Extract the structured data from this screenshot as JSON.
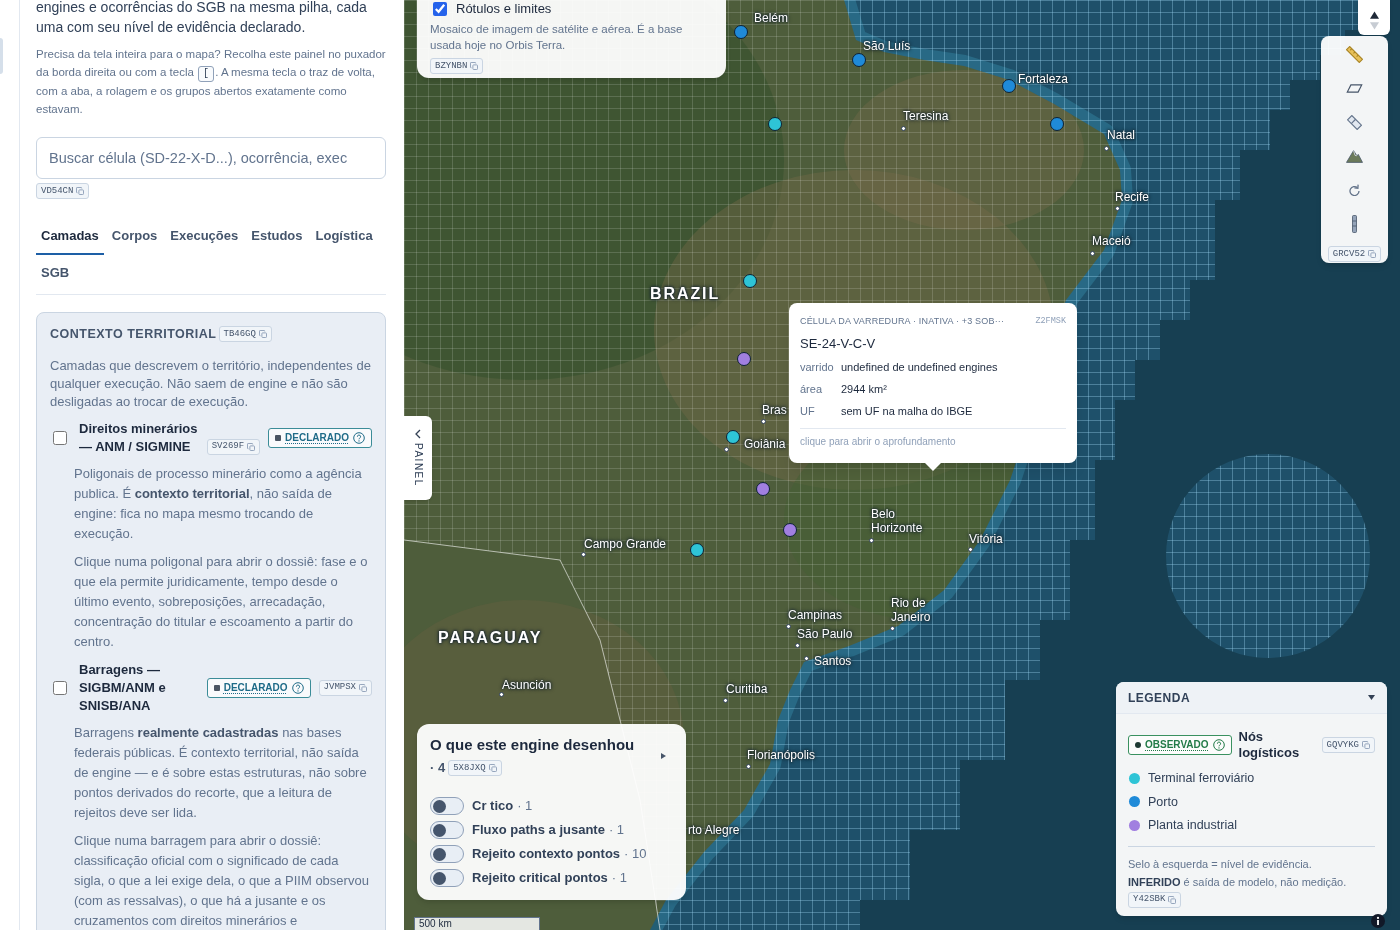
{
  "sidebar": {
    "intro": "engines e ocorrências do SGB na mesma pilha, cada uma com seu nível de evidência declarado.",
    "hint": {
      "before": "Precisa da tela inteira para o mapa? Recolha este painel no puxador da borda direita ou com a tecla ",
      "key": "[",
      "after": ". A mesma tecla o traz de volta, com a aba, a rolagem e os grupos abertos exatamente como estavam."
    },
    "search": {
      "placeholder": "Buscar célula (SD-22-X-D...), ocorrência, exec",
      "tag": "VD54CN"
    },
    "tabs": [
      {
        "label": "Camadas",
        "selected": true
      },
      {
        "label": "Corpos",
        "selected": false
      },
      {
        "label": "Execuções",
        "selected": false
      },
      {
        "label": "Estudos",
        "selected": false
      },
      {
        "label": "Logística",
        "selected": false
      },
      {
        "label": "SGB",
        "selected": false
      }
    ],
    "group": {
      "title": "CONTEXTO TERRITORIAL",
      "tag": "TB46GQ",
      "description": "Camadas que descrevem o território, independentes de qualquer execução. Não saem de engine e não são desligadas ao trocar de execução.",
      "layers": [
        {
          "title": "Direitos minerários — ANM / SIGMINE",
          "title_tag": "SV269F",
          "checked": false,
          "badge": {
            "label": "DECLARADO",
            "kind": "declarado"
          },
          "paragraphs": [
            "Poligonais de processo minerário como a agência publica. É **contexto territorial**, não saída de engine: fica no mapa mesmo trocando de execução.",
            "Clique numa poligonal para abrir o dossiê: fase e o que ela permite juridicamente, tempo desde o último evento, sobreposições, arrecadação, concentração do titular e escoamento a partir do centro."
          ]
        },
        {
          "title": "Barragens — SIGBM/ANM e SNISB/ANA",
          "tag": "JVMPSX",
          "checked": false,
          "badge": {
            "label": "DECLARADO",
            "kind": "declarado"
          },
          "paragraphs": [
            "Barragens **realmente cadastradas** nas bases federais públicas. É contexto territorial, não saída de engine — e é sobre estas estruturas, não sobre pontos derivados do recorte, que a leitura de rejeitos deve ser lida.",
            "Clique numa barragem para abrir o dossiê: classificação oficial com o significado de cada sigla, o que a lei exige dela, o que a PIIM observou (com as ressalvas), o que há a jusante e os cruzamentos com direitos minerários e"
          ]
        }
      ]
    }
  },
  "map": {
    "base_layer": {
      "label": "Rótulos e limites",
      "checked": true,
      "description": "Mosaico de imagem de satélite e aérea. É a base usada hoje no Orbis Terra.",
      "tag": "BZYNBN"
    },
    "labels": [
      {
        "text": "Belém",
        "kind": "city"
      },
      {
        "text": "São Luís",
        "kind": "city"
      },
      {
        "text": "Fortaleza",
        "kind": "city"
      },
      {
        "text": "Teresina",
        "kind": "city"
      },
      {
        "text": "Natal",
        "kind": "city"
      },
      {
        "text": "Recife",
        "kind": "city"
      },
      {
        "text": "Maceió",
        "kind": "city"
      },
      {
        "text": "BRAZIL",
        "kind": "country"
      },
      {
        "text": "Bras",
        "kind": "city"
      },
      {
        "text": "Goiânia",
        "kind": "city"
      },
      {
        "text": "Belo Horizonte",
        "kind": "wrapped"
      },
      {
        "text": "Campo Grande",
        "kind": "city"
      },
      {
        "text": "Vitória",
        "kind": "city"
      },
      {
        "text": "Campinas",
        "kind": "city"
      },
      {
        "text": "Rio de Janeiro",
        "kind": "wrapped"
      },
      {
        "text": "PARAGUAY",
        "kind": "country"
      },
      {
        "text": "São Paulo",
        "kind": "city"
      },
      {
        "text": "Santos",
        "kind": "city"
      },
      {
        "text": "Asunción",
        "kind": "city"
      },
      {
        "text": "Curitiba",
        "kind": "city"
      },
      {
        "text": "Florianópolis",
        "kind": "city"
      },
      {
        "text": "rto Alegre",
        "kind": "city"
      }
    ],
    "markers": [
      {
        "color": "#1f8ad8"
      },
      {
        "color": "#1f8ad8"
      },
      {
        "color": "#1f8ad8"
      },
      {
        "color": "#2ec4d6"
      },
      {
        "color": "#1f8ad8"
      },
      {
        "color": "#2ec4d6"
      },
      {
        "color": "#a17fe0"
      },
      {
        "color": "#2ec4d6"
      },
      {
        "color": "#a17fe0"
      },
      {
        "color": "#a17fe0"
      },
      {
        "color": "#2ec4d6"
      }
    ],
    "tools_tag": "GRCV52",
    "panel_handle": {
      "label": "PAINEL"
    },
    "tooltip": {
      "header": "CÉLULA DA VARREDURA · INATIVA · +3 SOB···",
      "code": "Z2FMSK",
      "title": "SE-24-V-C-V",
      "rows": [
        {
          "key": "varrido",
          "value": "undefined de undefined engines"
        },
        {
          "key": "área",
          "value": "2944 km²"
        },
        {
          "key": "UF",
          "value": "sem UF na malha do IBGE"
        }
      ],
      "footer": "clique para abrir o aprofundamento"
    },
    "engine_layers": {
      "title": "O que este engine desenhou",
      "count": "· 4",
      "tag": "5X8JXQ",
      "items": [
        {
          "name": "Cr tico",
          "count": "· 1",
          "on": false
        },
        {
          "name": "Fluxo paths a jusante",
          "count": "· 1",
          "on": false
        },
        {
          "name": "Rejeito contexto pontos",
          "count": "· 10",
          "on": false
        },
        {
          "name": "Rejeito critical pontos",
          "count": "· 1",
          "on": false
        }
      ]
    },
    "scale": "500 km",
    "legend": {
      "title": "LEGENDA",
      "expanded": true,
      "badge": {
        "label": "OBSERVADO",
        "kind": "observado"
      },
      "group_title": "Nós logísticos",
      "tag": "GQVYKG",
      "items": [
        {
          "label": "Terminal ferroviário",
          "color": "#2ec4d6"
        },
        {
          "label": "Porto",
          "color": "#1f8ad8"
        },
        {
          "label": "Planta industrial",
          "color": "#a17fe0"
        }
      ],
      "notes": [
        "Selo à esquerda = nível de evidência.",
        "**INFERIDO** é saída de modelo, não medição."
      ],
      "note_tag": "Y42SBK"
    }
  }
}
